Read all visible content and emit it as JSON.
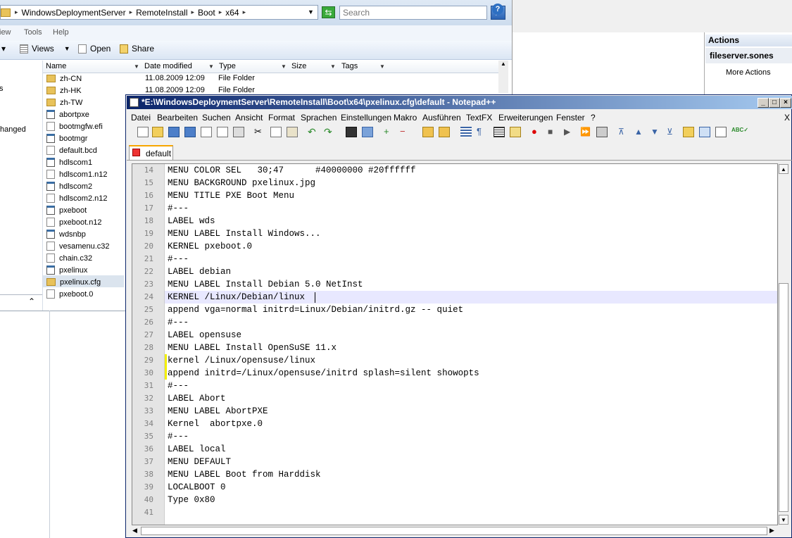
{
  "explorer": {
    "breadcrumb": [
      "WindowsDeploymentServer",
      "RemoteInstall",
      "Boot",
      "x64"
    ],
    "search_placeholder": "Search",
    "menu": [
      "View",
      "Tools",
      "Help"
    ],
    "menu_display": [
      "iew",
      "Tools",
      "Help"
    ],
    "toolbar": {
      "views": "Views",
      "open": "Open",
      "share": "Share"
    },
    "nav_partial": [
      "s",
      "hanged"
    ],
    "columns": [
      "Name",
      "Date modified",
      "Type",
      "Size",
      "Tags"
    ],
    "files": [
      {
        "name": "zh-CN",
        "date": "11.08.2009 12:09",
        "type": "File Folder",
        "icon": "folder-icon"
      },
      {
        "name": "zh-HK",
        "date": "11.08.2009 12:09",
        "type": "File Folder",
        "icon": "folder-icon"
      },
      {
        "name": "zh-TW",
        "icon": "folder-icon"
      },
      {
        "name": "abortpxe",
        "icon": "executable-icon"
      },
      {
        "name": "bootmgfw.efi",
        "icon": "file-icon"
      },
      {
        "name": "bootmgr",
        "icon": "executable-icon"
      },
      {
        "name": "default.bcd",
        "icon": "file-icon"
      },
      {
        "name": "hdlscom1",
        "icon": "executable-icon"
      },
      {
        "name": "hdlscom1.n12",
        "icon": "file-icon"
      },
      {
        "name": "hdlscom2",
        "icon": "executable-icon"
      },
      {
        "name": "hdlscom2.n12",
        "icon": "file-icon"
      },
      {
        "name": "pxeboot",
        "icon": "executable-icon"
      },
      {
        "name": "pxeboot.n12",
        "icon": "file-icon"
      },
      {
        "name": "wdsnbp",
        "icon": "executable-icon"
      },
      {
        "name": "vesamenu.c32",
        "icon": "file-icon"
      },
      {
        "name": "chain.c32",
        "icon": "file-icon"
      },
      {
        "name": "pxelinux",
        "icon": "executable-icon"
      },
      {
        "name": "pxelinux.cfg",
        "icon": "folder-icon"
      },
      {
        "name": "pxeboot.0",
        "icon": "file-icon"
      }
    ]
  },
  "actions": {
    "header": "Actions",
    "server": "fileserver.sones",
    "more": "More Actions"
  },
  "notepad": {
    "title": "*E:\\WindowsDeploymentServer\\RemoteInstall\\Boot\\x64\\pxelinux.cfg\\default - Notepad++",
    "menu": [
      "Datei",
      "Bearbeiten",
      "Suchen",
      "Ansicht",
      "Format",
      "Sprachen",
      "Einstellungen",
      "Makro",
      "Ausführen",
      "TextFX",
      "Erweiterungen",
      "Fenster",
      "?"
    ],
    "close_doc": "X",
    "tab": "default",
    "lines": [
      {
        "n": "14",
        "t": "MENU COLOR SEL   30;47      #40000000 #20ffffff"
      },
      {
        "n": "15",
        "t": "MENU BACKGROUND pxelinux.jpg"
      },
      {
        "n": "16",
        "t": "MENU TITLE PXE Boot Menu"
      },
      {
        "n": "17",
        "t": "#---"
      },
      {
        "n": "18",
        "t": "LABEL wds"
      },
      {
        "n": "19",
        "t": "MENU LABEL Install Windows..."
      },
      {
        "n": "20",
        "t": "KERNEL pxeboot.0"
      },
      {
        "n": "21",
        "t": "#---"
      },
      {
        "n": "22",
        "t": "LABEL debian"
      },
      {
        "n": "23",
        "t": "MENU LABEL Install Debian 5.0 NetInst"
      },
      {
        "n": "24",
        "t": "KERNEL /Linux/Debian/linux"
      },
      {
        "n": "25",
        "t": "append vga=normal initrd=Linux/Debian/initrd.gz -- quiet"
      },
      {
        "n": "26",
        "t": "#---"
      },
      {
        "n": "27",
        "t": "LABEL opensuse"
      },
      {
        "n": "28",
        "t": "MENU LABEL Install OpenSuSE 11.x"
      },
      {
        "n": "29",
        "t": "kernel /Linux/opensuse/linux"
      },
      {
        "n": "30",
        "t": "append initrd=/Linux/opensuse/initrd splash=silent showopts"
      },
      {
        "n": "31",
        "t": "#---"
      },
      {
        "n": "32",
        "t": "LABEL Abort"
      },
      {
        "n": "33",
        "t": "MENU LABEL AbortPXE"
      },
      {
        "n": "34",
        "t": "Kernel  abortpxe.0"
      },
      {
        "n": "35",
        "t": "#---"
      },
      {
        "n": "36",
        "t": "LABEL local"
      },
      {
        "n": "37",
        "t": "MENU DEFAULT"
      },
      {
        "n": "38",
        "t": "MENU LABEL Boot from Harddisk"
      },
      {
        "n": "39",
        "t": "LOCALBOOT 0"
      },
      {
        "n": "40",
        "t": "Type 0x80"
      },
      {
        "n": "41",
        "t": ""
      }
    ]
  }
}
